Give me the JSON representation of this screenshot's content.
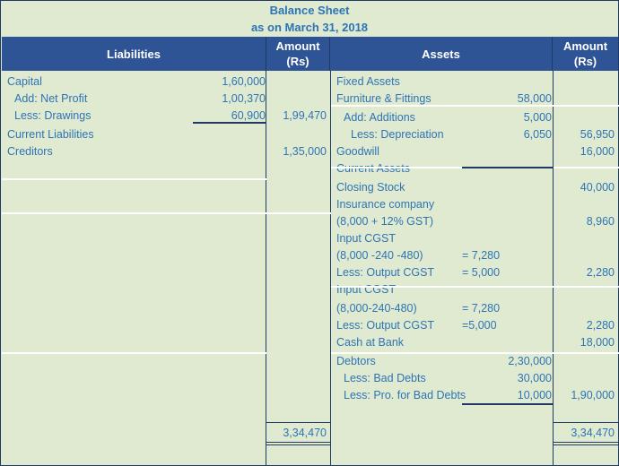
{
  "title": {
    "line1": "Balance Sheet",
    "line2": "as on March 31, 2018"
  },
  "header": {
    "liabilities": "Liabilities",
    "amount_1": "Amount",
    "amount_1_unit": "(Rs)",
    "assets": "Assets",
    "amount_2": "Amount",
    "amount_2_unit": "(Rs)"
  },
  "colors": {
    "header_bg": "#2e5496",
    "page_bg": "#dfead0",
    "text": "#2e74b5",
    "border": "#1f3864",
    "title": "#2e74b5"
  },
  "liabilities": [
    {
      "label": "Capital",
      "inner": "1,60,000",
      "amount": ""
    },
    {
      "label": "Add: Net Profit",
      "inner": "1,00,370",
      "amount": ""
    },
    {
      "label": "Less: Drawings",
      "inner": "60,900",
      "amount": "1,99,470"
    },
    {
      "label": "Current Liabilities",
      "inner": "",
      "amount": ""
    },
    {
      "label": "Creditors",
      "inner": "",
      "amount": "1,35,000"
    }
  ],
  "liabilities_total": "3,34,470",
  "assets": [
    {
      "label": "Fixed Assets",
      "inner": "",
      "eq": "",
      "amount": ""
    },
    {
      "label": "Furniture & Fittings",
      "inner": "58,000",
      "eq": "",
      "amount": ""
    },
    {
      "label": "Add: Additions",
      "inner": "5,000",
      "eq": "",
      "amount": ""
    },
    {
      "label": "Less: Depreciation",
      "inner": "6,050",
      "eq": "",
      "amount": "56,950"
    },
    {
      "label": "Goodwill",
      "inner": "",
      "eq": "",
      "amount": "16,000"
    },
    {
      "label": "Current Assets",
      "inner": "",
      "eq": "",
      "amount": ""
    },
    {
      "label": "Closing Stock",
      "inner": "",
      "eq": "",
      "amount": "40,000"
    },
    {
      "label": "Insurance company",
      "inner": "",
      "eq": "",
      "amount": ""
    },
    {
      "label": "(8,000 + 12% GST)",
      "inner": "",
      "eq": "",
      "amount": "8,960"
    },
    {
      "label": "Input CGST",
      "inner": "",
      "eq": "",
      "amount": ""
    },
    {
      "label": "(8,000 -240 -480)",
      "inner": "",
      "eq": "= 7,280",
      "amount": ""
    },
    {
      "label": "Less: Output CGST",
      "inner": "",
      "eq": "= 5,000",
      "amount": "2,280"
    },
    {
      "label": "Input CGST",
      "inner": "",
      "eq": "",
      "amount": ""
    },
    {
      "label": "(8,000-240-480)",
      "inner": "",
      "eq": "= 7,280",
      "amount": ""
    },
    {
      "label": "Less: Output CGST",
      "inner": "",
      "eq": "=5,000",
      "amount": "2,280"
    },
    {
      "label": "Cash at Bank",
      "inner": "",
      "eq": "",
      "amount": "18,000"
    },
    {
      "label": "Debtors",
      "inner": "2,30,000",
      "eq": "",
      "amount": ""
    },
    {
      "label": "Less: Bad Debts",
      "inner": "30,000",
      "eq": "",
      "amount": ""
    },
    {
      "label": "Less: Pro. for Bad Debts",
      "inner": "10,000",
      "eq": "",
      "amount": "1,90,000"
    }
  ],
  "assets_total": "3,34,470"
}
